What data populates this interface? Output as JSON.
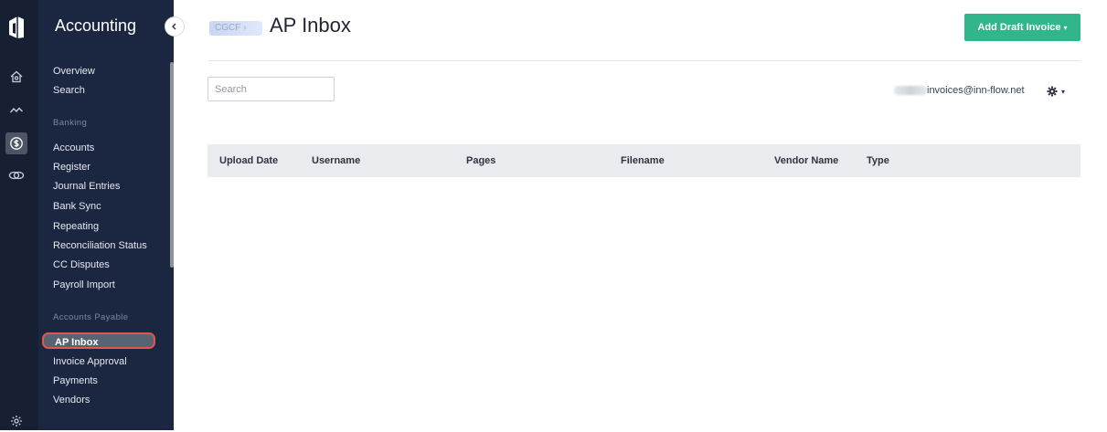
{
  "rail": {
    "icons": [
      "home-icon",
      "activity-icon",
      "dollar-icon",
      "handshake-icon",
      "settings-icon"
    ]
  },
  "sidebar": {
    "title": "Accounting",
    "top_items": [
      "Overview",
      "Search"
    ],
    "banking_section": "Banking",
    "banking_items": [
      "Accounts",
      "Register",
      "Journal Entries",
      "Bank Sync",
      "Repeating",
      "Reconciliation Status",
      "CC Disputes",
      "Payroll Import"
    ],
    "ap_section": "Accounts Payable",
    "ap_items": [
      "AP Inbox",
      "Invoice Approval",
      "Payments",
      "Vendors"
    ]
  },
  "header": {
    "breadcrumb": "CGCF ›",
    "title": "AP Inbox",
    "add_button": "Add Draft Invoice",
    "add_caret": "▾"
  },
  "toolbar": {
    "search_placeholder": "Search",
    "email": "invoices@inn-flow.net",
    "caret": "▾"
  },
  "table": {
    "columns": [
      "Upload Date",
      "Username",
      "Pages",
      "Filename",
      "Vendor Name",
      "Type"
    ]
  },
  "colors": {
    "rail_bg": "#172033",
    "sidebar_bg": "#1b2740",
    "accent": "#31b58a",
    "highlight_border": "#e2574c"
  }
}
